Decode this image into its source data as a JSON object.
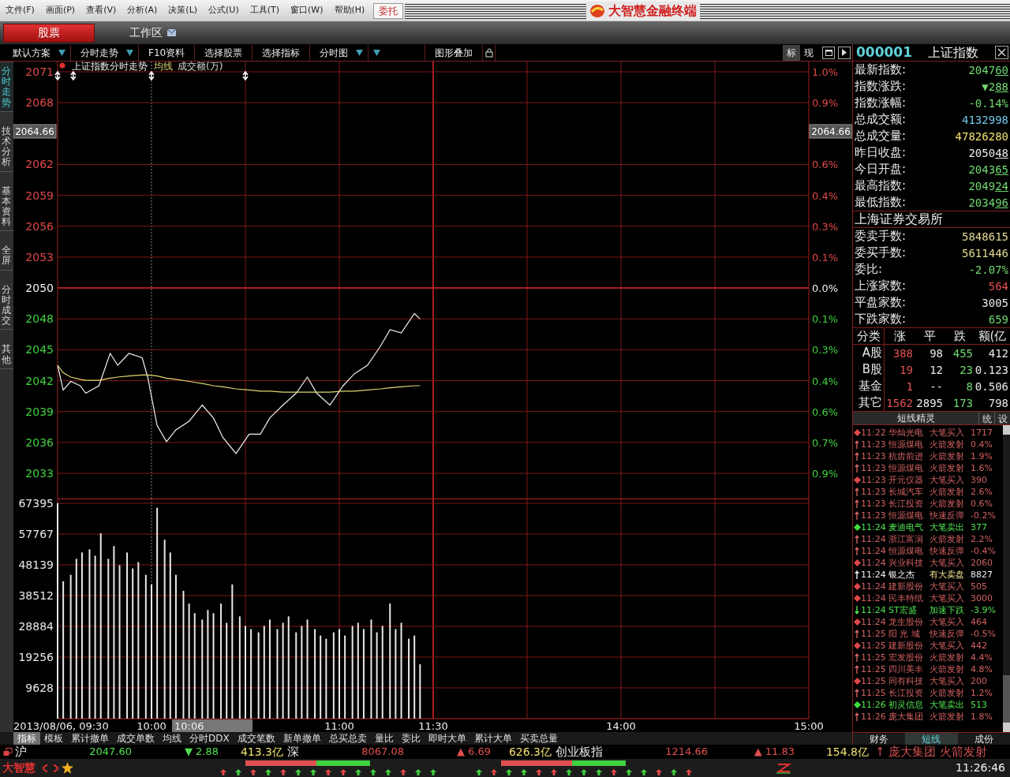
{
  "menu": {
    "items": [
      "文件(F)",
      "画面(P)",
      "查看(V)",
      "分析(A)",
      "决策(L)",
      "公式(U)",
      "工具(T)",
      "窗口(W)",
      "帮助(H)"
    ],
    "trade_button": "委托",
    "app_title": "大智慧金融终端"
  },
  "tab_bar": {
    "tabs": [
      {
        "label": "股票",
        "selected": true
      },
      {
        "label": "工作区",
        "selected": false
      }
    ]
  },
  "toolbar": {
    "items": [
      {
        "label": "默认方案",
        "dropdown": true
      },
      {
        "label": "分时走势",
        "dropdown": true
      },
      {
        "label": "F10资料",
        "dropdown": false
      },
      {
        "label": "选择股票",
        "dropdown": false
      },
      {
        "label": "选择指标",
        "dropdown": false
      },
      {
        "label": "分时图",
        "dropdown": true
      },
      {
        "dropdown": true
      },
      {
        "label": "图形叠加",
        "dropdown": false
      }
    ],
    "right_items": [
      "标",
      "现"
    ]
  },
  "side_tabs": [
    {
      "label": "分时走势",
      "selected": true
    },
    {
      "label": "技术分析",
      "selected": false
    },
    {
      "label": "基本资料",
      "selected": false
    },
    {
      "label": "全屏",
      "selected": false
    },
    {
      "label": "分时成交",
      "selected": false
    },
    {
      "label": "其他",
      "selected": false
    }
  ],
  "price_chart": {
    "percent_labels": [
      {
        "label": "1.0%",
        "color": "#e04848"
      },
      {
        "label": "0.9%",
        "color": "#e04848"
      },
      {
        "label": "0.6%",
        "color": "#e04848"
      },
      {
        "label": "0.4%",
        "color": "#e04848"
      },
      {
        "label": "0.3%",
        "color": "#e04848"
      },
      {
        "label": "0.1%",
        "color": "#e04848"
      },
      {
        "label": "0.0%",
        "color": "#f0f0f0"
      },
      {
        "label": "0.1%",
        "color": "#40d040"
      },
      {
        "label": "0.3%",
        "color": "#40d040"
      },
      {
        "label": "0.4%",
        "color": "#40d040"
      },
      {
        "label": "0.6%",
        "color": "#40d040"
      },
      {
        "label": "0.7%",
        "color": "#40d040"
      },
      {
        "label": "0.9%",
        "color": "#40d040"
      }
    ],
    "cursor_labels": [
      "2064.66",
      "2064.66"
    ],
    "chart_data": {
      "type": "line",
      "title": "上证指数分时走势",
      "grid": true,
      "ref_lines": [
        {
          "axis": "x",
          "value": 10
        },
        {
          "axis": "x",
          "value": 11.5
        }
      ],
      "xlim": [
        9.5,
        13.5
      ],
      "ylim": [
        2033.26,
        2070.57
      ],
      "yticks": [
        {
          "value": 2070.57,
          "label": "2071"
        },
        {
          "value": 2067.7,
          "label": "2068"
        },
        {
          "value": 2061.96,
          "label": "2062"
        },
        {
          "value": 2059.09,
          "label": "2059"
        },
        {
          "value": 2056.22,
          "label": "2056"
        },
        {
          "value": 2053.35,
          "label": "2053"
        },
        {
          "value": 2050.48,
          "label": "2050"
        },
        {
          "value": 2047.61,
          "label": "2048"
        },
        {
          "value": 2044.74,
          "label": "2045"
        },
        {
          "value": 2041.87,
          "label": "2042"
        },
        {
          "value": 2039,
          "label": "2039"
        },
        {
          "value": 2036.13,
          "label": "2036"
        },
        {
          "value": 2033.26,
          "label": "2033"
        }
      ],
      "x": [
        9.5,
        9.53,
        9.57,
        9.62,
        9.65,
        9.72,
        9.78,
        9.82,
        9.88,
        9.95,
        9.98,
        10.03,
        10.08,
        10.13,
        10.2,
        10.27,
        10.33,
        10.38,
        10.45,
        10.52,
        10.58,
        10.63,
        10.7,
        10.77,
        10.83,
        10.88,
        10.95,
        11.02,
        11.08,
        11.15,
        11.22,
        11.27,
        11.33,
        11.4,
        11.43
      ],
      "series": [
        {
          "color": "#f0f0f0",
          "values": [
            2043.3,
            2041,
            2041.8,
            2041.4,
            2040.7,
            2041.4,
            2044.4,
            2043.3,
            2044.4,
            2044,
            2042.2,
            2037.7,
            2036.2,
            2037.3,
            2038.1,
            2039.6,
            2038.4,
            2036.6,
            2035.1,
            2036.9,
            2036.9,
            2038.4,
            2039.6,
            2040.7,
            2042.2,
            2040.7,
            2039.6,
            2041.4,
            2042.5,
            2043.3,
            2045.1,
            2046.6,
            2046.3,
            2048.1,
            2047.6
          ]
        },
        {
          "name": "均线",
          "color": "#e0d870",
          "values": [
            2043.3,
            2042.6,
            2042.2,
            2042,
            2041.9,
            2041.9,
            2042.1,
            2042.2,
            2042.3,
            2042.4,
            2042.4,
            2042.3,
            2042.1,
            2042,
            2041.8,
            2041.6,
            2041.4,
            2041.3,
            2041.1,
            2041,
            2040.9,
            2040.9,
            2040.8,
            2040.8,
            2040.8,
            2040.8,
            2040.8,
            2040.9,
            2040.9,
            2041,
            2041.1,
            2041.2,
            2041.3,
            2041.4,
            2041.4
          ]
        }
      ]
    }
  },
  "volume_chart": {
    "cursor_time": "10:06",
    "afternoon_time_labels": [
      "14:00",
      "15:00"
    ],
    "chart_data": {
      "type": "bar",
      "grid": true,
      "ref_lines": [
        {
          "axis": "x",
          "value": 10
        },
        {
          "axis": "x",
          "value": 11.5
        }
      ],
      "xlim": [
        9.5,
        13.5
      ],
      "ylim": [
        0,
        67395
      ],
      "yticks": [
        9628,
        19256,
        28884,
        38512,
        48139,
        57767,
        67395
      ],
      "xticks": [
        {
          "value": 9.5,
          "label": "2013/08/06, 09:30"
        },
        {
          "value": 10,
          "label": "10:00"
        },
        {
          "value": 11,
          "label": "11:00"
        },
        {
          "value": 11.5,
          "label": "11:30"
        }
      ],
      "x": [
        9.5,
        9.53,
        9.57,
        9.6,
        9.63,
        9.67,
        9.7,
        9.73,
        9.77,
        9.8,
        9.83,
        9.87,
        9.9,
        9.93,
        9.97,
        10,
        10.03,
        10.07,
        10.1,
        10.13,
        10.17,
        10.2,
        10.23,
        10.27,
        10.3,
        10.33,
        10.37,
        10.4,
        10.43,
        10.47,
        10.5,
        10.53,
        10.57,
        10.6,
        10.63,
        10.67,
        10.7,
        10.73,
        10.77,
        10.8,
        10.83,
        10.87,
        10.9,
        10.93,
        10.97,
        11,
        11.03,
        11.07,
        11.1,
        11.13,
        11.17,
        11.2,
        11.23,
        11.27,
        11.3,
        11.33,
        11.37,
        11.4,
        11.43
      ],
      "series": [
        {
          "name": "成交额(万)",
          "color": "#e8e8e8",
          "values": [
            67395,
            43000,
            45000,
            50000,
            52000,
            53000,
            51000,
            58000,
            50000,
            54000,
            48000,
            52000,
            47000,
            49000,
            45000,
            42000,
            66000,
            56000,
            52000,
            45000,
            40000,
            36000,
            33000,
            31000,
            34000,
            33000,
            36000,
            30000,
            42000,
            32000,
            29000,
            28000,
            27000,
            29000,
            31000,
            28000,
            30000,
            32000,
            27000,
            29000,
            31000,
            28000,
            26000,
            25000,
            27000,
            28000,
            26000,
            29000,
            30000,
            28000,
            31000,
            27000,
            29000,
            36000,
            28000,
            30000,
            25000,
            26000,
            17000
          ]
        }
      ]
    }
  },
  "indicator_tabs": [
    {
      "label": "指标",
      "selected": true
    },
    {
      "label": "模板",
      "selected": false
    },
    {
      "label": "累计撤单",
      "selected": false
    },
    {
      "label": "成交单数",
      "selected": false
    },
    {
      "label": "均线",
      "selected": false
    },
    {
      "label": "分时DDX",
      "selected": false
    },
    {
      "label": "成交笔数",
      "selected": false
    },
    {
      "label": "新单撤单",
      "selected": false
    },
    {
      "label": "总买总卖",
      "selected": false
    },
    {
      "label": "量比",
      "selected": false
    },
    {
      "label": "委比",
      "selected": false
    },
    {
      "label": "即时大单",
      "selected": false
    },
    {
      "label": "累计大单",
      "selected": false
    },
    {
      "label": "买卖总量",
      "selected": false
    }
  ],
  "quote_panel": {
    "code": "000001",
    "name": "上证指数",
    "rows": [
      {
        "label": "最新指数:",
        "value": "2047",
        "decimals": "60",
        "color": "#70d870"
      },
      {
        "label": "指数涨跌:",
        "value": "▼2",
        "decimals": "88",
        "color": "#70d870"
      },
      {
        "label": "指数涨幅:",
        "value": "-0.14%",
        "color": "#70d870"
      },
      {
        "label": "总成交额:",
        "value": "4132998",
        "color": "#70c8e8"
      },
      {
        "label": "总成交量:",
        "value": "47826280",
        "color": "#f0e070"
      },
      {
        "label": "昨日收盘:",
        "value": "2050",
        "decimals": "48",
        "color": "#e8e8e8"
      },
      {
        "label": "今日开盘:",
        "value": "2043",
        "decimals": "65",
        "color": "#70d870"
      },
      {
        "label": "最高指数:",
        "value": "2049",
        "decimals": "24",
        "color": "#70d870"
      },
      {
        "label": "最低指数:",
        "value": "2034",
        "decimals": "96",
        "color": "#70d870"
      }
    ],
    "exchange": "上海证券交易所",
    "exchange_rows": [
      {
        "label": "委卖手数:",
        "value": "5848615",
        "color": "#e0d890"
      },
      {
        "label": "委买手数:",
        "value": "5611446",
        "color": "#e0d890"
      },
      {
        "label": "委比:",
        "value": "-2.07%",
        "color": "#70d870"
      },
      {
        "label": "上涨家数:",
        "value": "564",
        "color": "#e05050"
      },
      {
        "label": "平盘家数:",
        "value": "3005",
        "color": "#e8e8e8"
      },
      {
        "label": "下跌家数:",
        "value": "659",
        "color": "#70d870"
      }
    ],
    "table": {
      "columns": [
        "分类",
        "涨",
        "平",
        "跌",
        "额(亿"
      ],
      "rows": [
        [
          {
            "text": "A股",
            "color": "#e8e8e8"
          },
          {
            "text": "388",
            "color": "#e05050"
          },
          {
            "text": "98",
            "color": "#e8e8e8"
          },
          {
            "text": "455",
            "color": "#70d870"
          },
          {
            "text": "412",
            "color": "#e8e8e8"
          }
        ],
        [
          {
            "text": "B股",
            "color": "#e8e8e8"
          },
          {
            "text": "19",
            "color": "#e05050"
          },
          {
            "text": "12",
            "color": "#e8e8e8"
          },
          {
            "text": "23",
            "color": "#70d870"
          },
          {
            "text": "0.123",
            "color": "#e8e8e8"
          }
        ],
        [
          {
            "text": "基金",
            "color": "#e8e8e8"
          },
          {
            "text": "1",
            "color": "#e05050"
          },
          {
            "text": "--",
            "color": "#e8e8e8"
          },
          {
            "text": "8",
            "color": "#70d870"
          },
          {
            "text": "0.506",
            "color": "#e8e8e8"
          }
        ],
        [
          {
            "text": "其它",
            "color": "#e8e8e8"
          },
          {
            "text": "1562",
            "color": "#e05050"
          },
          {
            "text": "2895",
            "color": "#e8e8e8"
          },
          {
            "text": "173",
            "color": "#70d870"
          },
          {
            "text": "798",
            "color": "#e8e8e8"
          }
        ]
      ]
    },
    "alerts_title": "短线精灵",
    "alerts_buttons": [
      "统",
      "设"
    ],
    "alerts": [
      {
        "kind": "big_buy",
        "time": "11:22",
        "name": "华灿光电",
        "event": "大笔买入",
        "value": "1717"
      },
      {
        "kind": "rise",
        "time": "11:23",
        "name": "恒源煤电",
        "event": "火箭发射",
        "value": "0.4%"
      },
      {
        "kind": "rise",
        "time": "11:23",
        "name": "杭齿前进",
        "event": "火箭发射",
        "value": "1.9%"
      },
      {
        "kind": "rise",
        "time": "11:23",
        "name": "恒源煤电",
        "event": "火箭发射",
        "value": "1.6%"
      },
      {
        "kind": "big_buy",
        "time": "11:23",
        "name": "开元仪器",
        "event": "大笔买入",
        "value": "390"
      },
      {
        "kind": "rise",
        "time": "11:23",
        "name": "长城汽车",
        "event": "火箭发射",
        "value": "2.6%"
      },
      {
        "kind": "rise",
        "time": "11:23",
        "name": "长江投资",
        "event": "火箭发射",
        "value": "0.6%"
      },
      {
        "kind": "rise",
        "time": "11:23",
        "name": "恒源煤电",
        "event": "快速反弹",
        "value": "-0.2%"
      },
      {
        "kind": "big_sell",
        "time": "11:24",
        "name": "麦迪电气",
        "event": "大笔卖出",
        "value": "377"
      },
      {
        "kind": "rise",
        "time": "11:24",
        "name": "浙江富润",
        "event": "火箭发射",
        "value": "2.2%"
      },
      {
        "kind": "rise",
        "time": "11:24",
        "name": "恒源煤电",
        "event": "快速反弹",
        "value": "-0.4%"
      },
      {
        "kind": "big_buy",
        "time": "11:24",
        "name": "兴业科技",
        "event": "大笔买入",
        "value": "2060"
      },
      {
        "kind": "sell_offer",
        "time": "11:24",
        "name": "银之杰",
        "event": "有大卖盘",
        "value": "8827"
      },
      {
        "kind": "big_buy",
        "time": "11:24",
        "name": "建新股份",
        "event": "大笔买入",
        "value": "505"
      },
      {
        "kind": "big_buy",
        "time": "11:24",
        "name": "民丰特纸",
        "event": "大笔买入",
        "value": "3000"
      },
      {
        "kind": "fall",
        "time": "11:24",
        "name": "ST宏盛",
        "event": "加速下跌",
        "value": "-3.9%"
      },
      {
        "kind": "big_buy",
        "time": "11:24",
        "name": "龙生股份",
        "event": "大笔买入",
        "value": "464"
      },
      {
        "kind": "rise",
        "time": "11:25",
        "name": "阳 光 城",
        "event": "快速反弹",
        "value": "-0.5%"
      },
      {
        "kind": "big_buy",
        "time": "11:25",
        "name": "建新股份",
        "event": "大笔买入",
        "value": "442"
      },
      {
        "kind": "rise",
        "time": "11:25",
        "name": "宏发股份",
        "event": "火箭发射",
        "value": "4.4%"
      },
      {
        "kind": "rise",
        "time": "11:25",
        "name": "四川美丰",
        "event": "火箭发射",
        "value": "4.8%"
      },
      {
        "kind": "big_buy",
        "time": "11:25",
        "name": "同有科技",
        "event": "大笔买入",
        "value": "200"
      },
      {
        "kind": "rise",
        "time": "11:25",
        "name": "长江投资",
        "event": "火箭发射",
        "value": "1.2%"
      },
      {
        "kind": "big_sell",
        "time": "11:26",
        "name": "初灵信息",
        "event": "大笔卖出",
        "value": "513"
      },
      {
        "kind": "rise",
        "time": "11:26",
        "name": "庞大集团",
        "event": "火箭发射",
        "value": "1.8%"
      }
    ],
    "bottom_tabs": [
      {
        "label": "财务",
        "selected": false
      },
      {
        "label": "短线",
        "selected": true
      },
      {
        "label": "成份",
        "selected": false
      }
    ]
  },
  "ticker": {
    "markets": [
      {
        "name": "沪",
        "price": "2047.60",
        "change": "▼ 2.88",
        "color": "#50e050",
        "turnover": "413.3亿"
      },
      {
        "name": "深",
        "price": "8067.08",
        "change": "▲ 6.69",
        "color": "#e05050",
        "turnover": "626.3亿"
      },
      {
        "name": "创业板指",
        "price": "1214.66",
        "change": "▲ 11.83",
        "color": "#e05050",
        "turnover": "154.8亿"
      }
    ],
    "alert": "↑ 庞大集团 火箭发射"
  },
  "status_bar": {
    "brand": "大智慧",
    "time": "11:26:46"
  }
}
